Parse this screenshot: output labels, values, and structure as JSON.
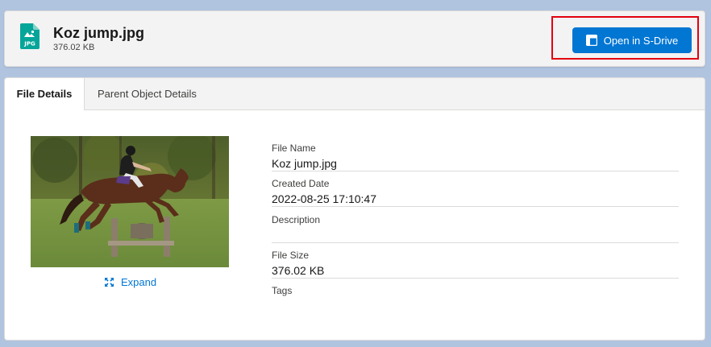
{
  "header": {
    "file_type_label": "JPG",
    "title": "Koz jump.jpg",
    "size": "376.02 KB",
    "open_button_label": "Open in S-Drive"
  },
  "tabs": [
    {
      "label": "File Details",
      "active": true
    },
    {
      "label": "Parent Object Details",
      "active": false
    }
  ],
  "preview": {
    "expand_label": "Expand"
  },
  "details": [
    {
      "label": "File Name",
      "value": "Koz jump.jpg"
    },
    {
      "label": "Created Date",
      "value": "2022-08-25 17:10:47"
    },
    {
      "label": "Description",
      "value": ""
    },
    {
      "label": "File Size",
      "value": "376.02 KB"
    },
    {
      "label": "Tags",
      "value": ""
    }
  ],
  "colors": {
    "accent": "#0176d3",
    "highlight": "#e3000f",
    "jpg_icon": "#06a59a"
  }
}
